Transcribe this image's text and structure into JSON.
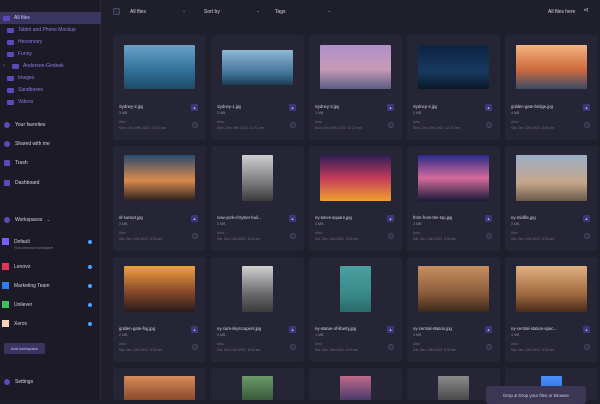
{
  "sidebar": {
    "folders": [
      {
        "label": "All files",
        "selected": true
      },
      {
        "label": "Tablet and Phone Mockup"
      },
      {
        "label": "Hexometry"
      },
      {
        "label": "Funny"
      },
      {
        "label": "Anderson-Grotesk",
        "expandable": true
      },
      {
        "label": "Images"
      },
      {
        "label": "Sandboxes"
      },
      {
        "label": "Videos"
      }
    ],
    "nav": {
      "favorites": "Your favorites",
      "shared": "Shared with me",
      "trash": "Trash",
      "dashboard": "Dashboard"
    },
    "workspaces_title": "Workspaces",
    "workspaces": [
      {
        "label": "Default",
        "sub": "Your personal workspace",
        "color": "#7c5cff"
      },
      {
        "label": "Lenovo",
        "color": "#e3335a"
      },
      {
        "label": "Marketing Team",
        "color": "#2f7df6"
      },
      {
        "label": "Unilever",
        "color": "#3ec25c"
      },
      {
        "label": "Xerox",
        "color": "#f6d3b8"
      }
    ],
    "add_workspace": "Add workspace",
    "settings": "Settings"
  },
  "toolbar": {
    "filter": "All files",
    "sort": "Sort by",
    "tags": "Tags",
    "right_label": "All files here"
  },
  "files": [
    {
      "name": "Sydney-2.jpg",
      "size": "3 MB",
      "owner": "Artur",
      "date": "Mon, Dec 19th 2022, 12:21 am"
    },
    {
      "name": "Sydney-1.jpg",
      "size": "3 MB",
      "owner": "Artur",
      "date": "Mon, Dec 19th 2022, 12:21 am"
    },
    {
      "name": "Sydney-3.jpg",
      "size": "1 MB",
      "owner": "Artur",
      "date": "Mon, Dec 19th 2022, 12:22 am"
    },
    {
      "name": "Sydney-4.jpg",
      "size": "3 MB",
      "owner": "Artur",
      "date": "Mon, Dec 19th 2022, 12:22 am"
    },
    {
      "name": "golden-gate-bridge.jpg",
      "size": "4 MB",
      "owner": "Artur",
      "date": "Sat, Dec 10th 2022, 6:00 am"
    },
    {
      "name": "sf-sunset.jpg",
      "size": "3 MB",
      "owner": "Artur",
      "date": "Sat, Dec 10th 2022, 6:00 am"
    },
    {
      "name": "new-york-chrysler-buil...",
      "size": "3 MB",
      "owner": "Artur",
      "date": "Sat, Dec 10th 2022, 6:00 am"
    },
    {
      "name": "ny-times-square.jpg",
      "size": "3 MB",
      "owner": "Artur",
      "date": "Sat, Dec 10th 2022, 6:00 am"
    },
    {
      "name": "from-from-the-top.jpg",
      "size": "3 MB",
      "owner": "Artur",
      "date": "Sat, Dec 10th 2022, 6:00 am"
    },
    {
      "name": "ny-midlife.jpg",
      "size": "3 MB",
      "owner": "Artur",
      "date": "Sat, Dec 10th 2022, 6:00 am"
    },
    {
      "name": "golden-gate-fog.jpg",
      "size": "2 MB",
      "owner": "Artur",
      "date": "Sat, Dec 10th 2022, 6:00 am"
    },
    {
      "name": "ny-cars-skyscrapers.jpg",
      "size": "3 MB",
      "owner": "Artur",
      "date": "Sat, Dec 10th 2022, 6:00 am"
    },
    {
      "name": "ny-statue-of-liberty.jpg",
      "size": "1 MB",
      "owner": "Artur",
      "date": "Sat, Dec 10th 2022, 6:00 am"
    },
    {
      "name": "ny-central-station.jpg",
      "size": "3 MB",
      "owner": "Artur",
      "date": "Sat, Dec 10th 2022, 6:00 am"
    },
    {
      "name": "ny-central-station-spac...",
      "size": "4 MB",
      "owner": "Artur",
      "date": "Sat, Dec 10th 2022, 6:00 am"
    }
  ],
  "toast": "Drop & Drop your files or Browse"
}
